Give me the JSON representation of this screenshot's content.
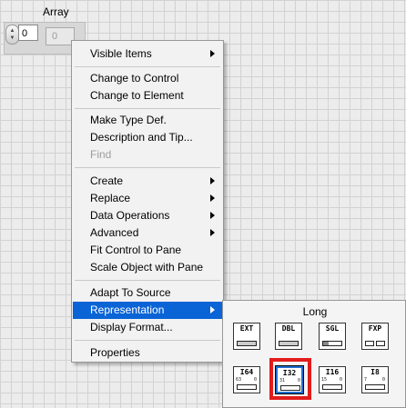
{
  "canvas": {
    "array_label": "Array",
    "index_value": "0",
    "element_value": "0",
    "spinner_up": "▲",
    "spinner_down": "▼"
  },
  "menu": {
    "items": [
      {
        "label": "Visible Items",
        "submenu": true,
        "disabled": false,
        "selected": false
      },
      {
        "label": "Change to Control",
        "submenu": false,
        "disabled": false,
        "selected": false
      },
      {
        "label": "Change to Element",
        "submenu": false,
        "disabled": false,
        "selected": false
      },
      {
        "label": "Make Type Def.",
        "submenu": false,
        "disabled": false,
        "selected": false
      },
      {
        "label": "Description and Tip...",
        "submenu": false,
        "disabled": false,
        "selected": false
      },
      {
        "label": "Find",
        "submenu": false,
        "disabled": true,
        "selected": false
      },
      {
        "label": "Create",
        "submenu": true,
        "disabled": false,
        "selected": false
      },
      {
        "label": "Replace",
        "submenu": true,
        "disabled": false,
        "selected": false
      },
      {
        "label": "Data Operations",
        "submenu": true,
        "disabled": false,
        "selected": false
      },
      {
        "label": "Advanced",
        "submenu": true,
        "disabled": false,
        "selected": false
      },
      {
        "label": "Fit Control to Pane",
        "submenu": false,
        "disabled": false,
        "selected": false
      },
      {
        "label": "Scale Object with Pane",
        "submenu": false,
        "disabled": false,
        "selected": false
      },
      {
        "label": "Adapt To Source",
        "submenu": false,
        "disabled": false,
        "selected": false
      },
      {
        "label": "Representation",
        "submenu": true,
        "disabled": false,
        "selected": true
      },
      {
        "label": "Display Format...",
        "submenu": false,
        "disabled": false,
        "selected": false
      },
      {
        "label": "Properties",
        "submenu": false,
        "disabled": false,
        "selected": false
      }
    ]
  },
  "representation": {
    "title": "Long",
    "tiles": [
      {
        "code": "EXT",
        "range_lo": "",
        "range_hi": "",
        "field": "dots",
        "selected": false
      },
      {
        "code": "DBL",
        "range_lo": "",
        "range_hi": "",
        "field": "dots",
        "selected": false
      },
      {
        "code": "SGL",
        "range_lo": "",
        "range_hi": "",
        "field": "bar",
        "selected": false
      },
      {
        "code": "FXP",
        "range_lo": "",
        "range_hi": "",
        "field": "fxp",
        "selected": false
      },
      {
        "code": "I64",
        "range_lo": "63",
        "range_hi": "0",
        "field": "plain",
        "selected": false
      },
      {
        "code": "I32",
        "range_lo": "31",
        "range_hi": "0",
        "field": "plain",
        "selected": true
      },
      {
        "code": "I16",
        "range_lo": "15",
        "range_hi": "0",
        "field": "plain",
        "selected": false
      },
      {
        "code": "I8",
        "range_lo": "7",
        "range_hi": "0",
        "field": "plain",
        "selected": false
      }
    ],
    "highlight_color": "#e21c1c",
    "selection_color": "#1f6fd0"
  }
}
